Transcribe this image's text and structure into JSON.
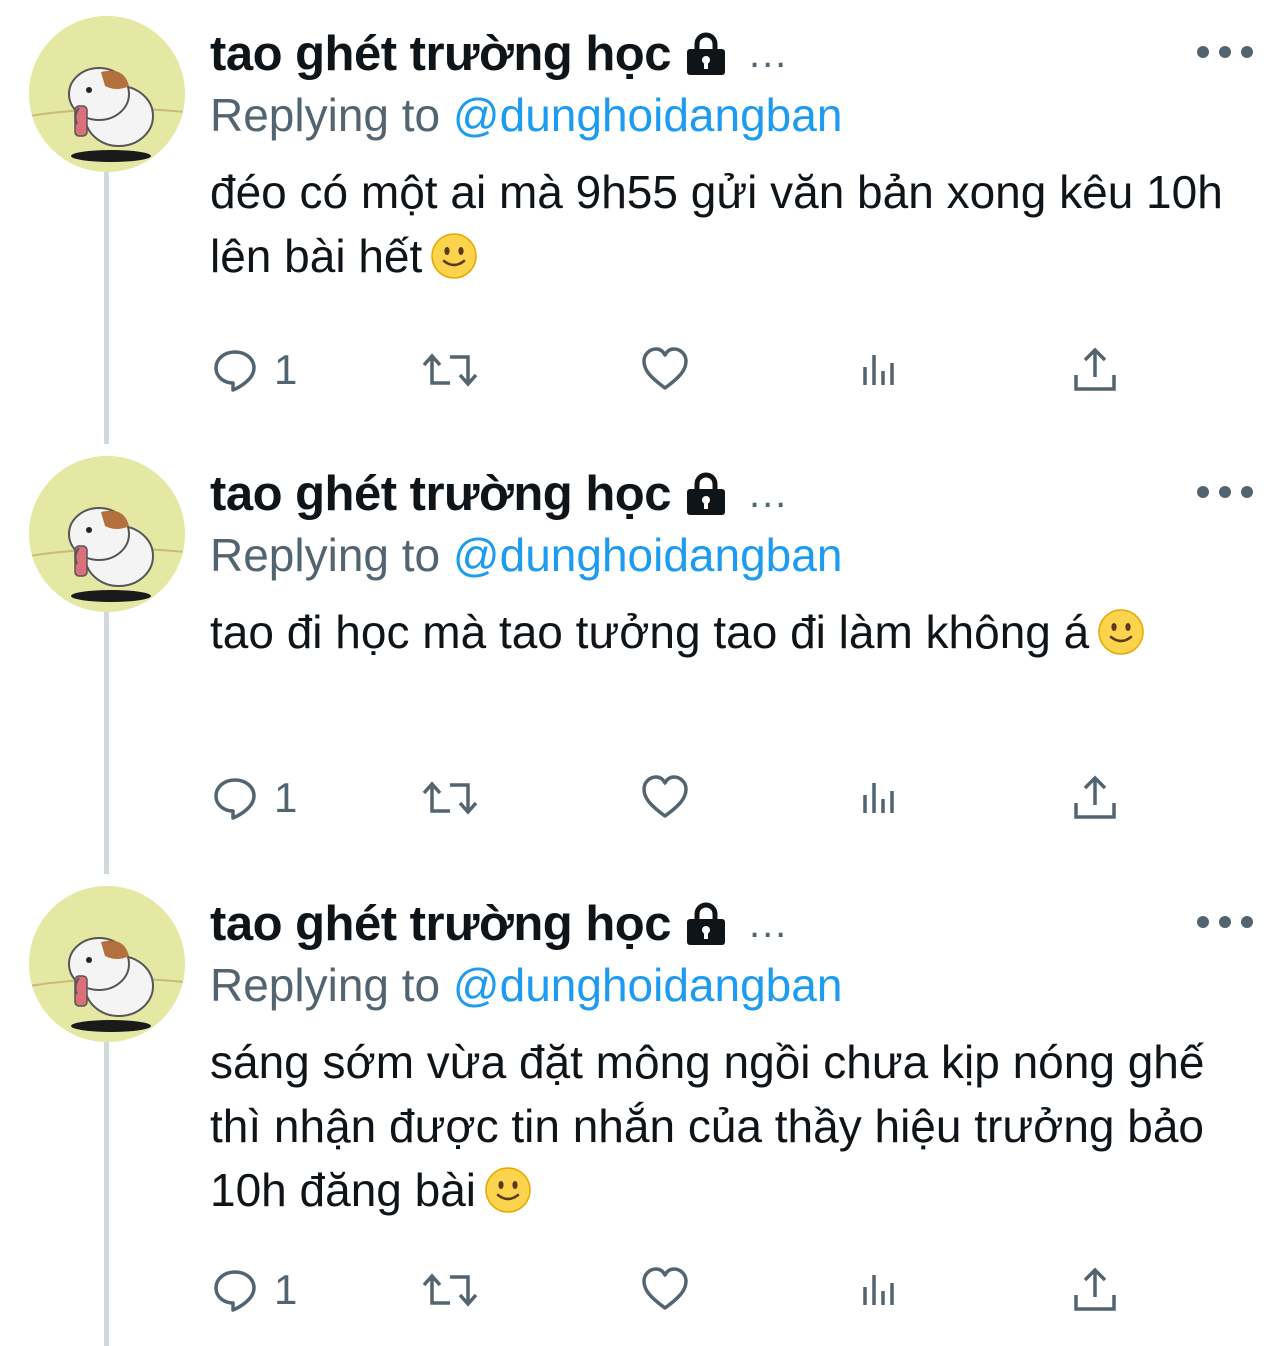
{
  "tweets": [
    {
      "author_name": "tao ghét trường học",
      "header_ellipsis": "...",
      "reply_prefix": "Replying to",
      "reply_handle": "@dunghoidangban",
      "text": "đéo có một ai mà 9h55 gửi văn bản xong kêu 10h lên bài hết",
      "emoji": "slightly-smiling-face",
      "reply_count": "1"
    },
    {
      "author_name": "tao ghét trường học",
      "header_ellipsis": "...",
      "reply_prefix": "Replying to",
      "reply_handle": "@dunghoidangban",
      "text": "tao đi học mà tao tưởng tao đi làm không á",
      "emoji": "slightly-smiling-face",
      "reply_count": "1"
    },
    {
      "author_name": "tao ghét trường học",
      "header_ellipsis": "...",
      "reply_prefix": "Replying to",
      "reply_handle": "@dunghoidangban",
      "text": "sáng sớm vừa đặt mông ngồi chưa kịp nóng ghế thì nhận được tin nhắn của thầy hiệu trưởng bảo 10h đăng bài",
      "emoji": "slightly-smiling-face",
      "reply_count": "1"
    }
  ],
  "icons": {
    "reply": "reply-icon",
    "retweet": "retweet-icon",
    "like": "heart-icon",
    "views": "views-icon",
    "share": "share-icon",
    "lock": "lock-icon",
    "more": "more-icon"
  },
  "colors": {
    "accent": "#1d9bf0",
    "secondary_text": "#536471",
    "thread_line": "#cfd9de",
    "avatar_bg": "#e5e8a3"
  }
}
